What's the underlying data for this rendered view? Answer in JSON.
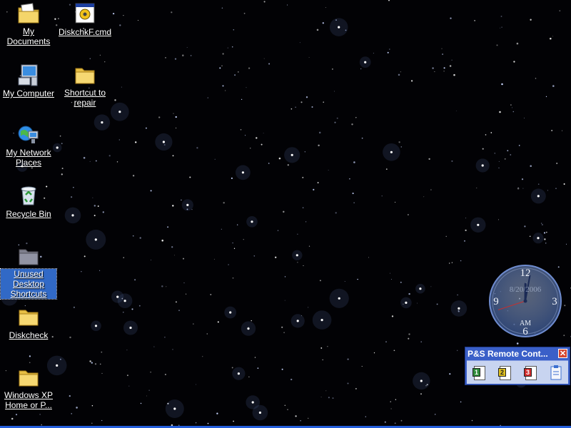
{
  "desktop": {
    "icons": [
      {
        "id": "my-documents",
        "label": "My Documents",
        "icon": "my-documents-icon",
        "selected": false
      },
      {
        "id": "diskchkf-cmd",
        "label": "DiskchkF.cmd",
        "icon": "cmd-script-icon",
        "selected": false
      },
      {
        "id": "my-computer",
        "label": "My Computer",
        "icon": "my-computer-icon",
        "selected": false
      },
      {
        "id": "shortcut-to-repair",
        "label": "Shortcut to repair",
        "icon": "folder-icon",
        "selected": false
      },
      {
        "id": "my-network-places",
        "label": "My Network Places",
        "icon": "network-places-icon",
        "selected": false
      },
      {
        "id": "recycle-bin",
        "label": "Recycle Bin",
        "icon": "recycle-bin-icon",
        "selected": false
      },
      {
        "id": "unused-desktop-shortcuts",
        "label": "Unused Desktop Shortcuts",
        "icon": "folder-icon",
        "selected": true
      },
      {
        "id": "diskcheck",
        "label": "Diskcheck",
        "icon": "folder-icon",
        "selected": false
      },
      {
        "id": "windows-xp-home",
        "label": "Windows XP Home or P...",
        "icon": "folder-icon",
        "selected": false
      }
    ]
  },
  "clock": {
    "date": "8/20/2006",
    "ampm": "AM",
    "numerals": [
      "12",
      "3",
      "6",
      "9"
    ],
    "time": {
      "hour": 12,
      "minute": 1,
      "second": 42
    }
  },
  "remote": {
    "title": "P&S Remote Cont...",
    "close_icon": "close-icon",
    "buttons": [
      {
        "label": "1",
        "color": "#2e8b3a",
        "icon": "document-1-icon"
      },
      {
        "label": "2",
        "color": "#e0c020",
        "icon": "document-2-icon"
      },
      {
        "label": "3",
        "color": "#d02a2a",
        "icon": "document-3-icon"
      },
      {
        "label": "",
        "color": "#3b6fd0",
        "icon": "clipboard-icon"
      }
    ]
  },
  "colors": {
    "selection": "#3169c6",
    "panel": "#3a5fc8",
    "taskbar": "#245edb"
  }
}
